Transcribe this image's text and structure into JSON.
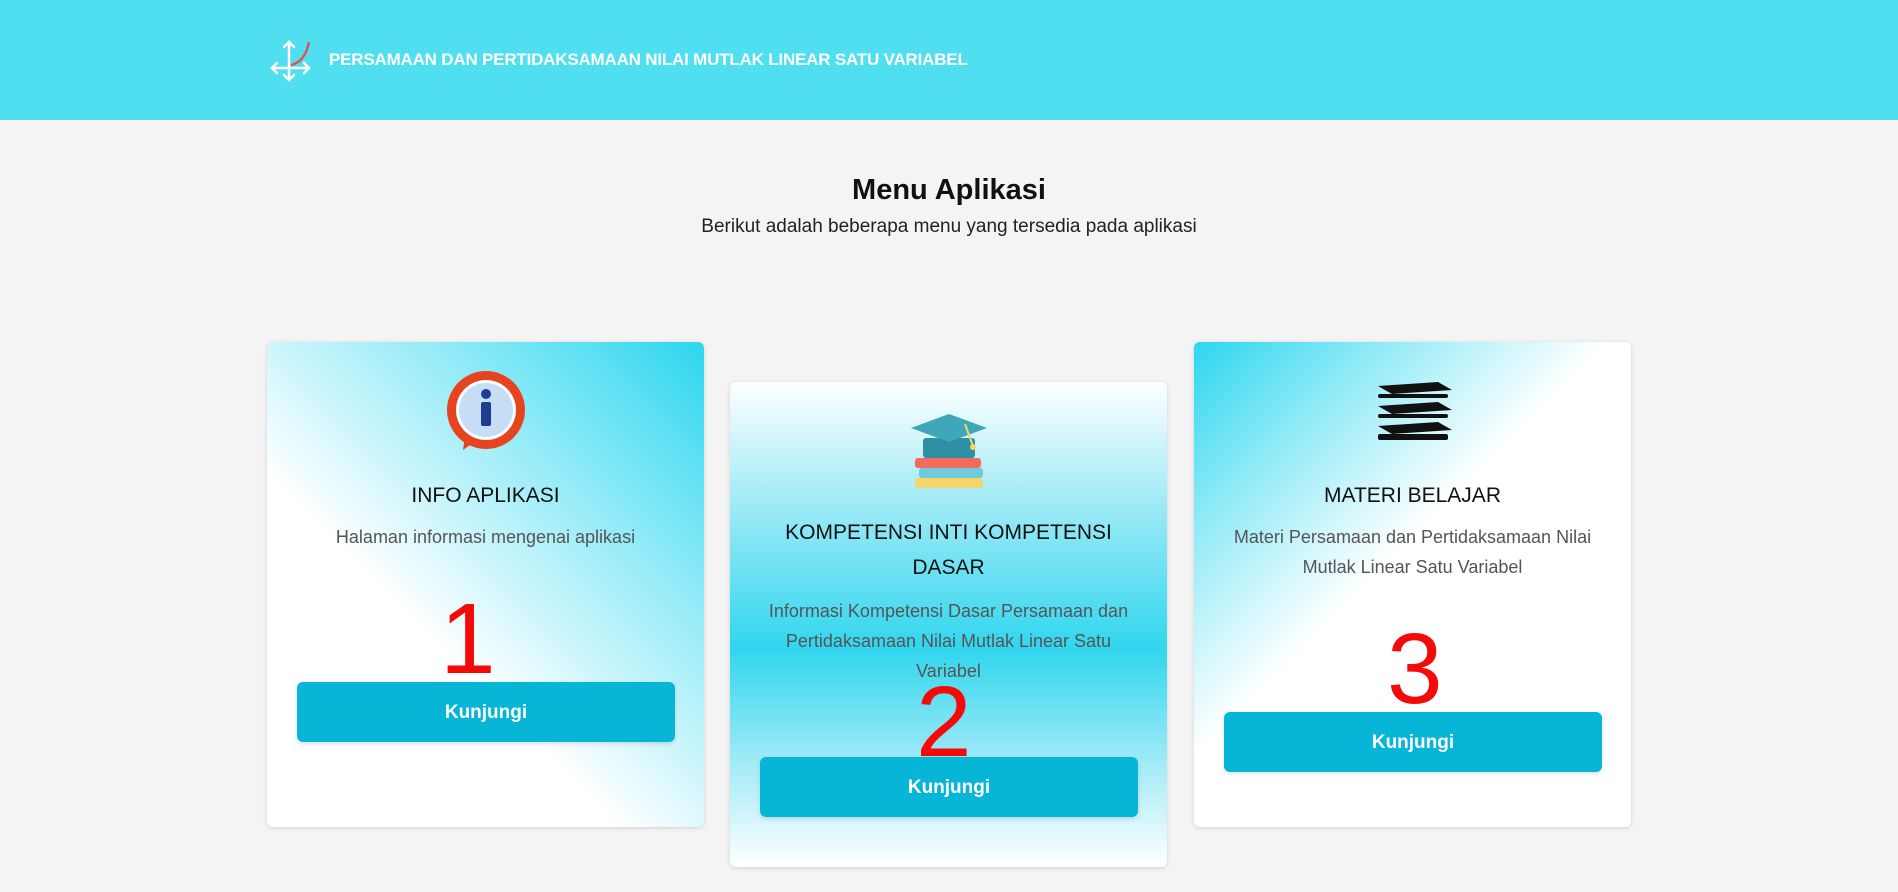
{
  "header": {
    "icon": "graph-axes-icon",
    "title": "PERSAMAAN DAN PERTIDAKSAMAAN NILAI MUTLAK LINEAR SATU VARIABEL"
  },
  "main": {
    "heading": "Menu Aplikasi",
    "subheading": "Berikut adalah beberapa menu yang tersedia pada aplikasi"
  },
  "cards": [
    {
      "icon": "info-icon",
      "title": "INFO APLIKASI",
      "description": "Halaman informasi mengenai aplikasi",
      "button_label": "Kunjungi",
      "marker": "1"
    },
    {
      "icon": "graduation-books-icon",
      "title": "KOMPETENSI INTI KOMPETENSI DASAR",
      "description": "Informasi Kompetensi Dasar Persamaan dan Pertidaksamaan Nilai Mutlak Linear Satu Variabel",
      "button_label": "Kunjungi",
      "marker": "2"
    },
    {
      "icon": "books-stack-icon",
      "title": "MATERI BELAJAR",
      "description": "Materi Persamaan dan Pertidaksamaan Nilai Mutlak Linear Satu Variabel",
      "button_label": "Kunjungi",
      "marker": "3"
    }
  ],
  "colors": {
    "header_bg": "#50dff0",
    "button_bg": "#07b5d6",
    "marker": "#f50a0a",
    "page_bg": "#f4f4f4"
  }
}
